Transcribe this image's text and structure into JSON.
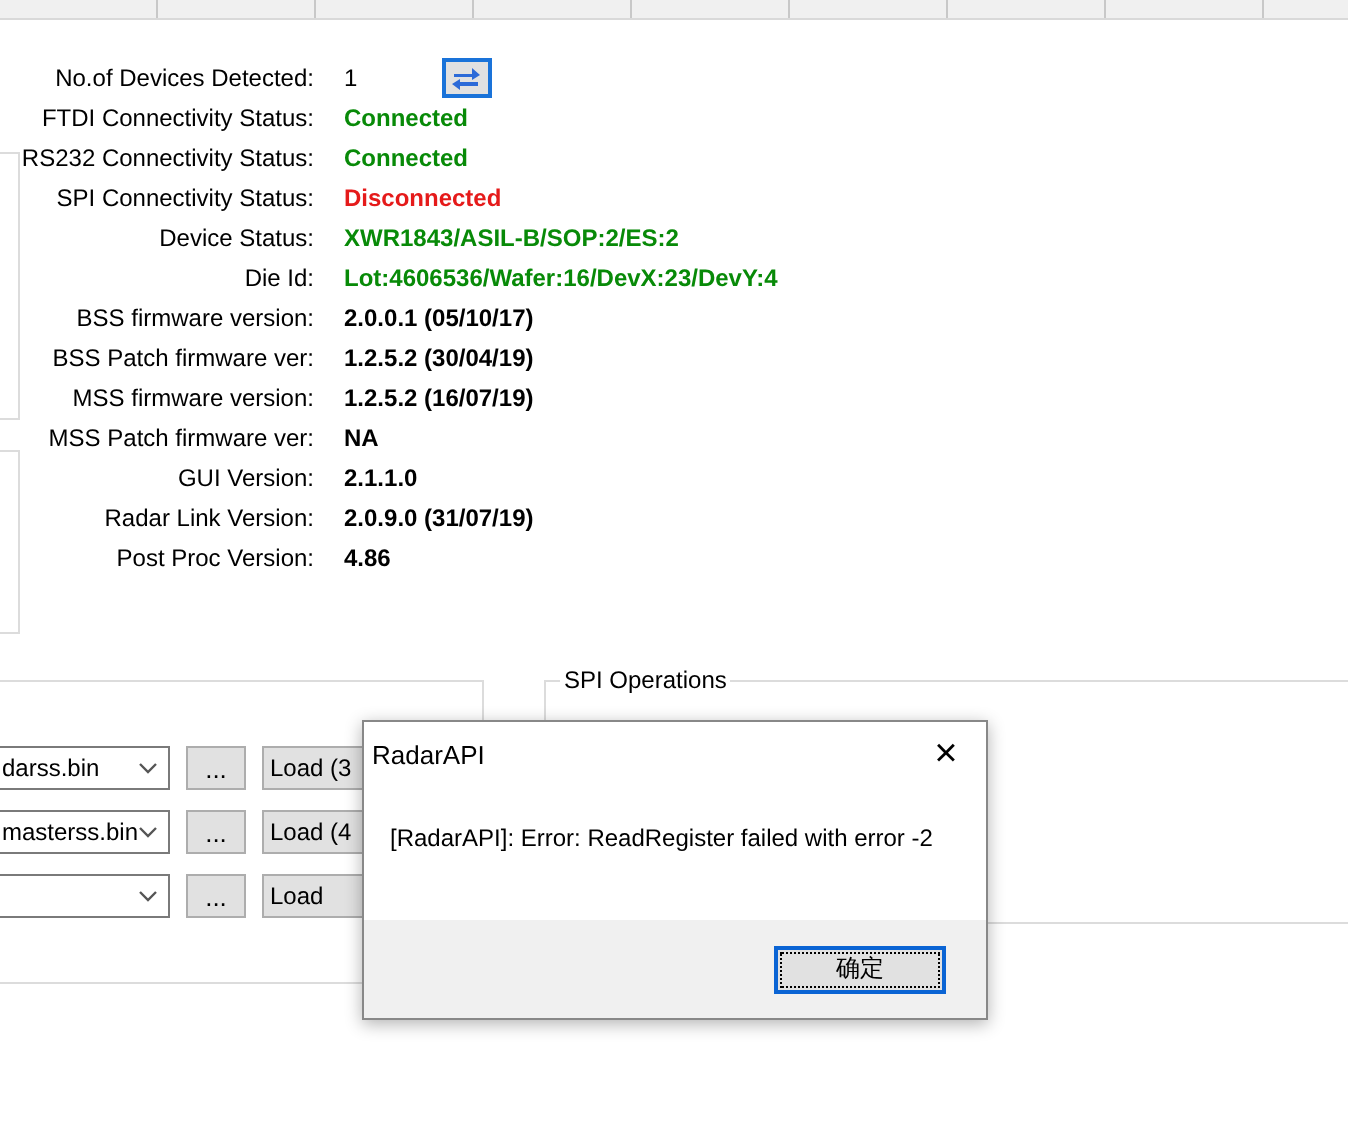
{
  "device_count": {
    "label": "No.of Devices Detected:",
    "value": "1"
  },
  "info_rows": [
    {
      "label": "FTDI Connectivity Status:",
      "value": "Connected",
      "kind": "good"
    },
    {
      "label": "RS232 Connectivity Status:",
      "value": "Connected",
      "kind": "good"
    },
    {
      "label": "SPI Connectivity Status:",
      "value": "Disconnected",
      "kind": "bad"
    },
    {
      "label": "Device Status:",
      "value": "XWR1843/ASIL-B/SOP:2/ES:2",
      "kind": "good"
    },
    {
      "label": "Die Id:",
      "value": "Lot:4606536/Wafer:16/DevX:23/DevY:4",
      "kind": "good"
    },
    {
      "label": "BSS firmware version:",
      "value": "2.0.0.1 (05/10/17)",
      "kind": "plain"
    },
    {
      "label": "BSS Patch firmware ver:",
      "value": "1.2.5.2 (30/04/19)",
      "kind": "plain"
    },
    {
      "label": "MSS firmware version:",
      "value": "1.2.5.2 (16/07/19)",
      "kind": "plain"
    },
    {
      "label": "MSS Patch firmware ver:",
      "value": "NA",
      "kind": "plain"
    },
    {
      "label": "GUI Version:",
      "value": "2.1.1.0",
      "kind": "plain"
    },
    {
      "label": "Radar Link Version:",
      "value": "2.0.9.0 (31/07/19)",
      "kind": "plain"
    },
    {
      "label": "Post Proc Version:",
      "value": "4.86",
      "kind": "plain"
    }
  ],
  "file_rows": [
    {
      "file": "darss.bin",
      "browse": "...",
      "load": "Load (3"
    },
    {
      "file": "masterss.bin",
      "browse": "...",
      "load": "Load (4"
    },
    {
      "browse": "...",
      "load": "Load"
    }
  ],
  "spi_group": {
    "title": "SPI Operations"
  },
  "dialog": {
    "title": "RadarAPI",
    "close": "×",
    "message": "[RadarAPI]: Error: ReadRegister failed with error -2",
    "ok": "确定"
  }
}
